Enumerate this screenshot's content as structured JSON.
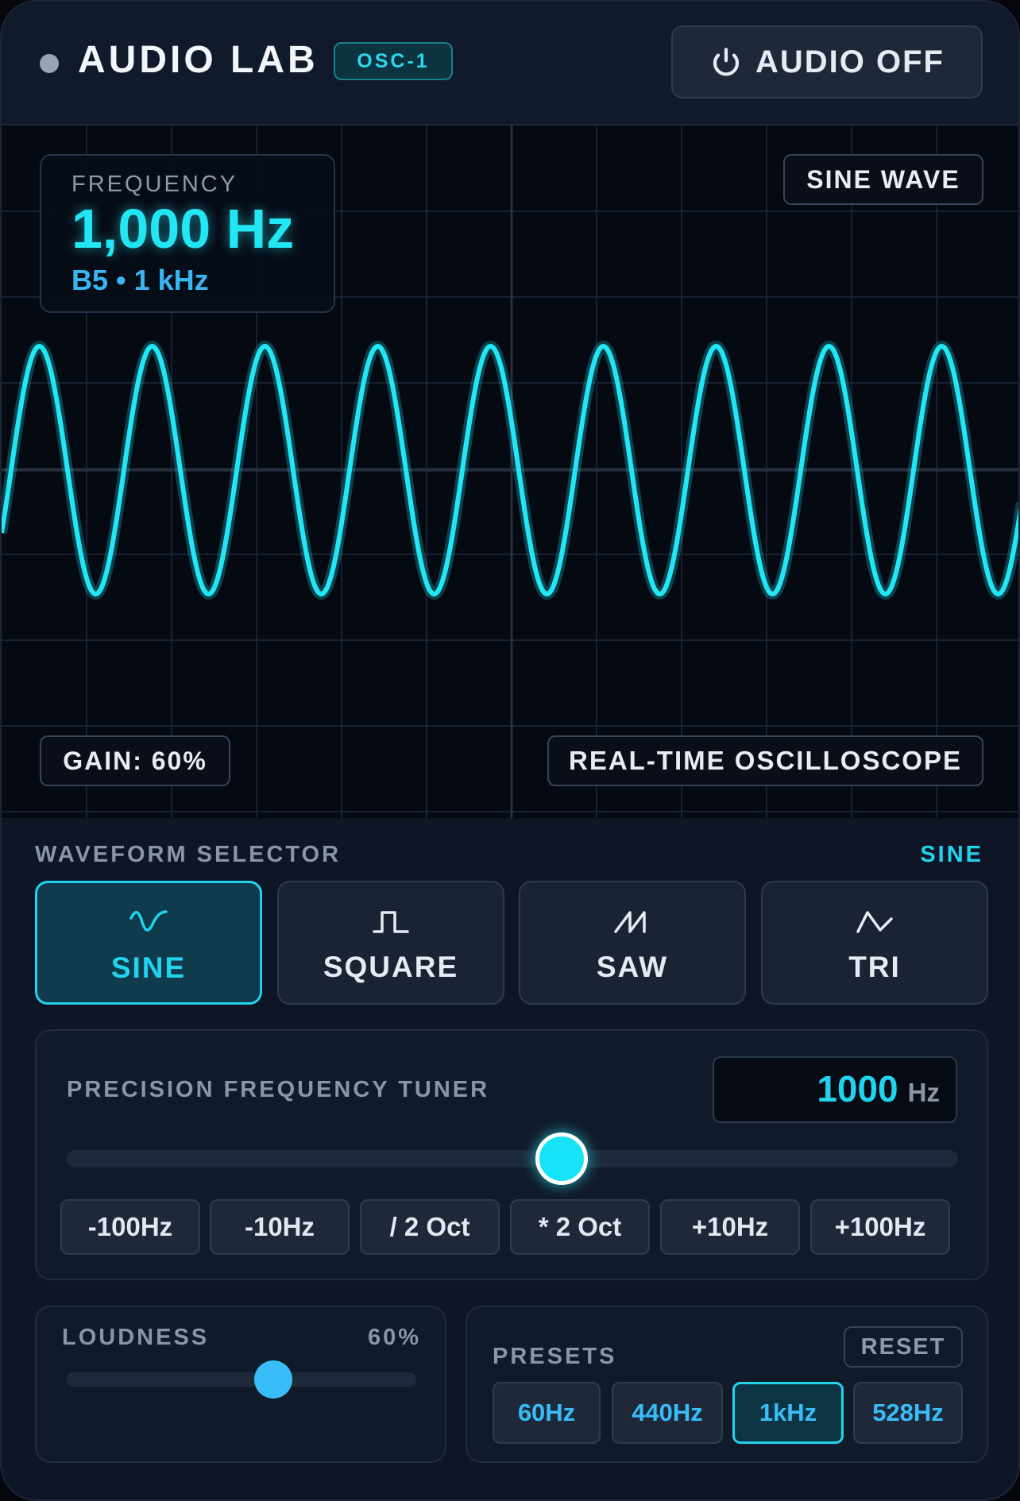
{
  "header": {
    "title": "AUDIO LAB",
    "badge": "OSC-1",
    "audio_button": "AUDIO OFF",
    "audio_icon": "power-icon"
  },
  "scope": {
    "frequency_label": "FREQUENCY",
    "frequency_value": "1,000 Hz",
    "frequency_note": "B5 • 1 kHz",
    "wave_tag": "SINE WAVE",
    "gain_tag": "GAIN: 60%",
    "mode_tag": "REAL-TIME OSCILLOSCOPE",
    "trace_color": "#22e6f4",
    "grid_color": "#182232"
  },
  "waveform_selector": {
    "label": "WAVEFORM SELECTOR",
    "current": "SINE",
    "options": [
      {
        "label": "SINE",
        "icon": "sine-wave-icon",
        "active": true
      },
      {
        "label": "SQUARE",
        "icon": "square-wave-icon",
        "active": false
      },
      {
        "label": "SAW",
        "icon": "saw-wave-icon",
        "active": false
      },
      {
        "label": "TRI",
        "icon": "triangle-wave-icon",
        "active": false
      }
    ]
  },
  "tuner": {
    "label": "PRECISION FREQUENCY TUNER",
    "value": "1000",
    "unit": "Hz",
    "slider_level": 0.56,
    "steps": [
      "-100Hz",
      "-10Hz",
      "/ 2 Oct",
      "* 2 Oct",
      "+10Hz",
      "+100Hz"
    ]
  },
  "loudness": {
    "label": "LOUDNESS",
    "value": "60%",
    "level": 0.6
  },
  "presets": {
    "label": "PRESETS",
    "reset": "RESET",
    "items": [
      {
        "label": "60Hz",
        "active": false
      },
      {
        "label": "440Hz",
        "active": false
      },
      {
        "label": "1kHz",
        "active": true
      },
      {
        "label": "528Hz",
        "active": false
      }
    ]
  },
  "colors": {
    "accent": "#22d3ee",
    "secondary": "#38bdf8",
    "background": "#0e1626"
  }
}
